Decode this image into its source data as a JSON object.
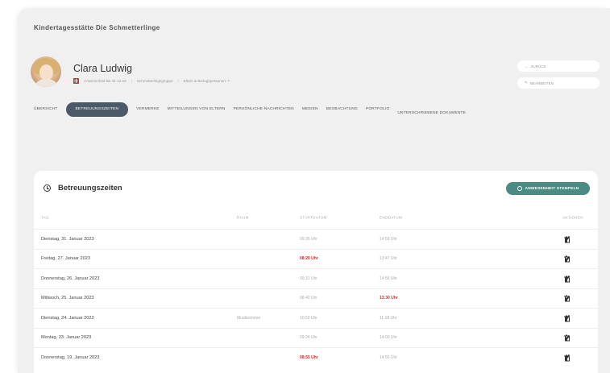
{
  "app": {
    "title": "Kindertagesstätte Die Schmetterlinge"
  },
  "profile": {
    "name": "Clara Ludwig",
    "meta_items": [
      "Anwesenheit bis 31.12.23",
      "Schmetterlingsgruppe",
      "Eltern & Bezugspersonen: 7"
    ],
    "back_label": "ZURÜCK",
    "edit_label": "BEARBEITEN"
  },
  "tabs": [
    {
      "label": "ÜBERSICHT",
      "active": false
    },
    {
      "label": "BETREUUNGSZEITEN",
      "active": true
    },
    {
      "label": "VERMERKE",
      "active": false
    },
    {
      "label": "MITTEILUNGEN VON ELTERN",
      "active": false
    },
    {
      "label": "PERSÖNLICHE NACHRICHTEN",
      "active": false
    },
    {
      "label": "MEDIEN",
      "active": false
    },
    {
      "label": "BEOBACHTUNG",
      "active": false
    },
    {
      "label": "PORTFOLIO",
      "active": false
    },
    {
      "label": "UNTERSCHRIEBENE DOKUMENTE",
      "active": false
    }
  ],
  "section": {
    "title": "Betreuungszeiten",
    "stamp_button": "ANWESENHEIT STEMPELN",
    "columns": {
      "tag": "TAG",
      "raum": "RAUM",
      "start": "STARTDATUM",
      "end": "ENDDATUM",
      "actions": "AKTIONEN"
    },
    "rows": [
      {
        "tag": "Dienstag, 31. Januar 2023",
        "raum": "",
        "start": "09:35 Uhr",
        "end": "14:59 Uhr",
        "start_late": false,
        "end_late": false
      },
      {
        "tag": "Freitag, 27. Januar 2023",
        "raum": "",
        "start": "08:20 Uhr",
        "end": "13:47 Uhr",
        "start_late": true,
        "end_late": false
      },
      {
        "tag": "Donnerstag, 26. Januar 2023",
        "raum": "",
        "start": "09:31 Uhr",
        "end": "14:56 Uhr",
        "start_late": false,
        "end_late": false
      },
      {
        "tag": "Mittwoch, 25. Januar 2023",
        "raum": "",
        "start": "08:40 Uhr",
        "end": "13:30 Uhr",
        "start_late": false,
        "end_late": true
      },
      {
        "tag": "Dienstag, 24. Januar 2023",
        "raum": "Musikzimmer",
        "start": "10:50 Uhr",
        "end": "11:18 Uhr",
        "start_late": false,
        "end_late": false
      },
      {
        "tag": "Montag, 23. Januar 2023",
        "raum": "",
        "start": "09:34 Uhr",
        "end": "14:00 Uhr",
        "start_late": false,
        "end_late": false
      },
      {
        "tag": "Donnerstag, 19. Januar 2023",
        "raum": "",
        "start": "08:55 Uhr",
        "end": "14:55 Uhr",
        "start_late": true,
        "end_late": false
      }
    ]
  },
  "colors": {
    "accent": "#4c8b84",
    "active_tab": "#4a5a69",
    "late": "#cc2f2f"
  },
  "icons": {
    "row_actions": [
      "info-icon",
      "edit-icon",
      "trash-icon"
    ]
  }
}
